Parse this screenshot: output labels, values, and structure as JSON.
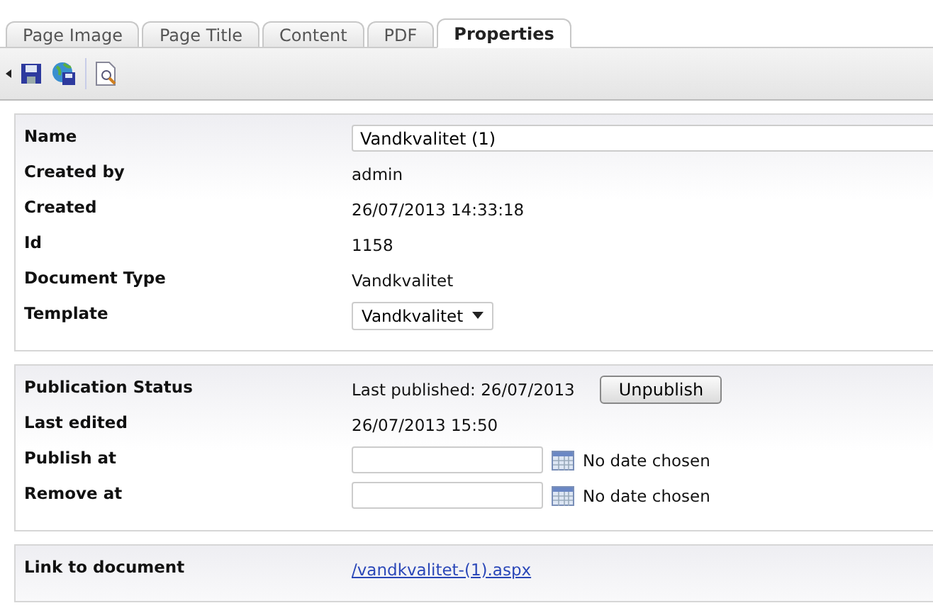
{
  "tabs": [
    {
      "label": "Page Image",
      "selected": false
    },
    {
      "label": "Page Title",
      "selected": false
    },
    {
      "label": "Content",
      "selected": false
    },
    {
      "label": "PDF",
      "selected": false
    },
    {
      "label": "Properties",
      "selected": true
    }
  ],
  "panels": [
    {
      "rows": [
        {
          "kind": "input",
          "label": "Name",
          "value": "Vandkvalitet (1)"
        },
        {
          "kind": "text",
          "label": "Created by",
          "value": "admin"
        },
        {
          "kind": "text",
          "label": "Created",
          "value": "26/07/2013 14:33:18"
        },
        {
          "kind": "text",
          "label": "Id",
          "value": "1158"
        },
        {
          "kind": "text",
          "label": "Document Type",
          "value": "Vandkvalitet"
        },
        {
          "kind": "select",
          "label": "Template",
          "value": "Vandkvalitet"
        }
      ]
    },
    {
      "rows": [
        {
          "kind": "publish",
          "label": "Publication Status",
          "value": "Last published: 26/07/2013",
          "button": "Unpublish"
        },
        {
          "kind": "text",
          "label": "Last edited",
          "value": "26/07/2013 15:50"
        },
        {
          "kind": "date",
          "label": "Publish at",
          "value": "No date chosen"
        },
        {
          "kind": "date",
          "label": "Remove at",
          "value": "No date chosen"
        }
      ]
    },
    {
      "rows": [
        {
          "kind": "link",
          "label": "Link to document",
          "value": "/vandkvalitet-(1).aspx"
        }
      ]
    }
  ]
}
